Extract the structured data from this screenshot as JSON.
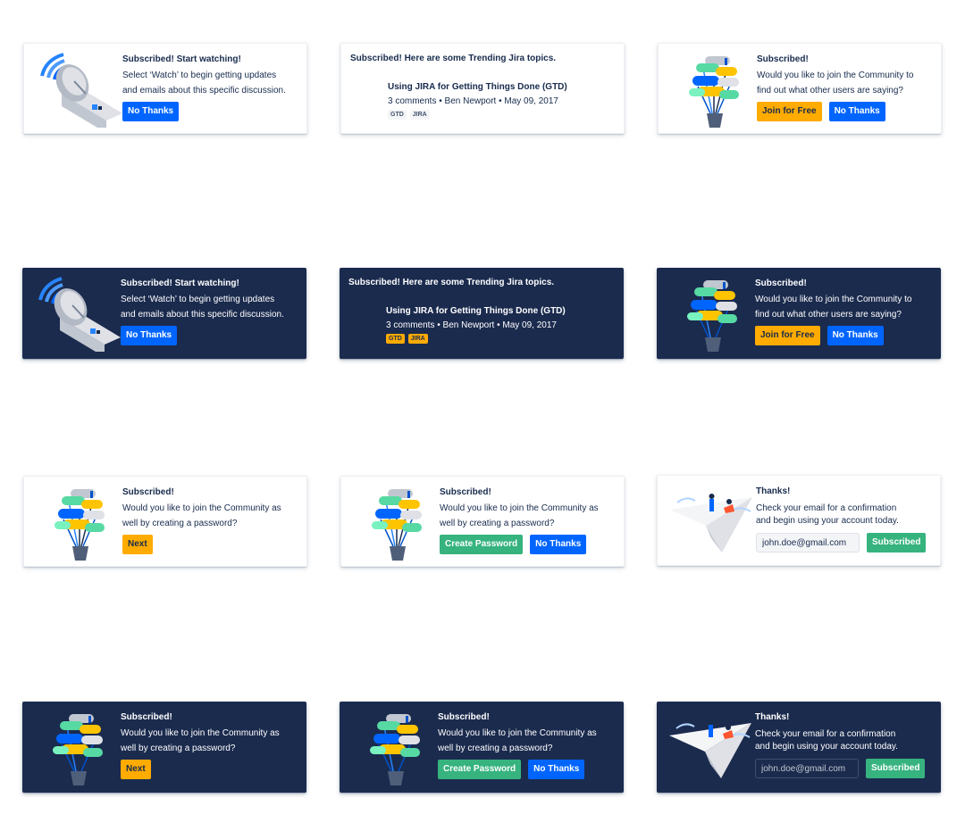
{
  "colors": {
    "dark_bg": "#1b2b4e",
    "primary_blue": "#0065ff",
    "accent_yellow": "#ffab00",
    "success_green": "#36b37e",
    "text": "#172b4d"
  },
  "watch": {
    "title": "Subscribed! Start watching!",
    "line1": "Select ‘Watch’ to begin getting updates",
    "line2": "and emails about this specific discussion.",
    "no_thanks": "No Thanks",
    "illustration": "satellite-dish-icon"
  },
  "trending": {
    "title": "Subscribed! Here are some Trending Jira topics.",
    "topic_title": "Using JIRA for Getting Things Done (GTD)",
    "topic_meta": "3 comments • Ben Newport • May 09, 2017",
    "tags": [
      "GTD",
      "JIRA"
    ],
    "prev_icon": "chevron-left-icon",
    "next_icon": "chevron-right-icon"
  },
  "join": {
    "title": "Subscribed!",
    "line1": "Would you like to join the Community to",
    "line2": "find out what other users are saying?",
    "join_free": "Join for Free",
    "no_thanks": "No Thanks",
    "illustration": "chat-bubbles-icon"
  },
  "password": {
    "title": "Subscribed!",
    "line1": "Would you like to join the Community as",
    "line2": "well by creating a password?",
    "next": "Next",
    "create_password": "Create Password",
    "no_thanks": "No Thanks"
  },
  "thanks": {
    "title": "Thanks!",
    "line1": "Check your email for a confirmation",
    "line2": "and begin using your account today.",
    "email_value": "john.doe@gmail.com",
    "subscribed": "Subscribed",
    "illustration": "paper-plane-icon"
  },
  "close_icon": "close-icon"
}
